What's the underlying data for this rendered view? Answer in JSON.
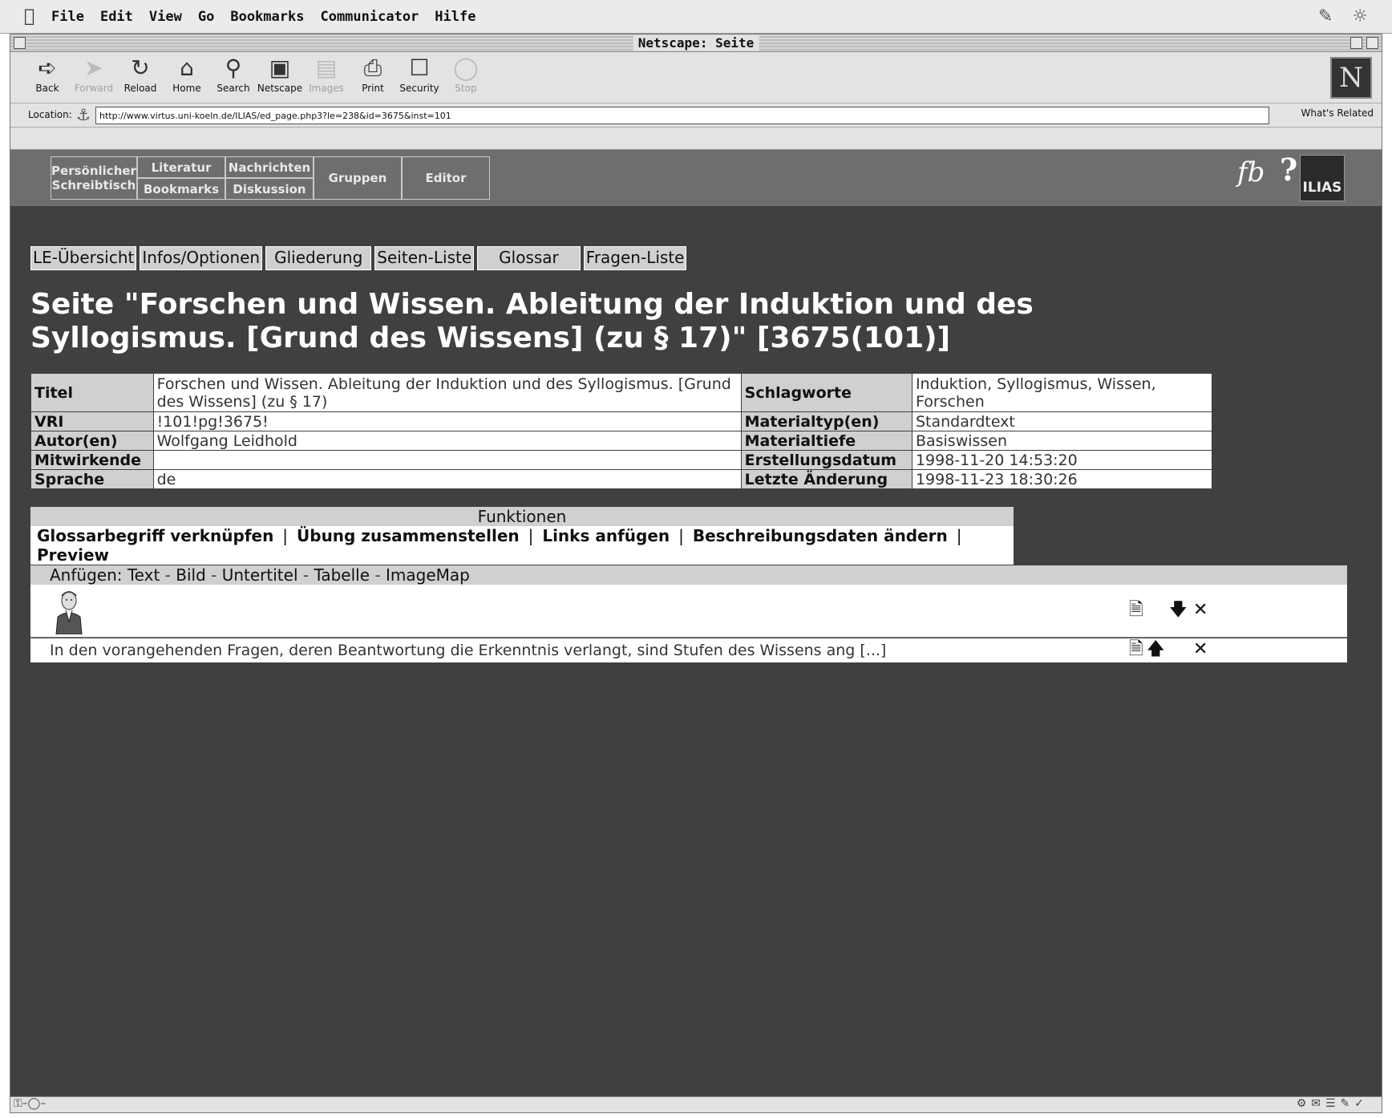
{
  "menubar": {
    "items": [
      "File",
      "Edit",
      "View",
      "Go",
      "Bookmarks",
      "Communicator",
      "Hilfe"
    ]
  },
  "window": {
    "title": "Netscape: Seite"
  },
  "toolbar": {
    "back": "Back",
    "forward": "Forward",
    "reload": "Reload",
    "home": "Home",
    "search": "Search",
    "netscape": "Netscape",
    "images": "Images",
    "print": "Print",
    "security": "Security",
    "stop": "Stop"
  },
  "location": {
    "label": "Location:",
    "url": "http://www.virtus.uni-koeln.de/ILIAS/ed_page.php3?le=238&id=3675&inst=101",
    "whats_related": "What's Related"
  },
  "ilias_nav": {
    "persoenlicher": "Persönlicher Schreibtisch",
    "literatur": "Literatur",
    "bookmarks": "Bookmarks",
    "nachrichten": "Nachrichten",
    "diskussion": "Diskussion",
    "gruppen": "Gruppen",
    "editor": "Editor",
    "logo": "ILIAS",
    "help": "?"
  },
  "tabs": [
    "LE-Übersicht",
    "Infos/Optionen",
    "Gliederung",
    "Seiten-Liste",
    "Glossar",
    "Fragen-Liste"
  ],
  "page_title": "Seite \"Forschen und Wissen. Ableitung der Induktion und des Syllogismus. [Grund des Wissens] (zu § 17)\" [3675(101)]",
  "meta": {
    "titel_label": "Titel",
    "titel": "Forschen und Wissen. Ableitung der Induktion und des Syllogismus. [Grund des Wissens] (zu § 17)",
    "schlagworte_label": "Schlagworte",
    "schlagworte": "Induktion, Syllogismus, Wissen, Forschen",
    "vri_label": "VRI",
    "vri": "!101!pg!3675!",
    "materialtyp_label": "Materialtyp(en)",
    "materialtyp": "Standardtext",
    "autor_label": "Autor(en)",
    "autor": "Wolfgang Leidhold",
    "materialtiefe_label": "Materialtiefe",
    "materialtiefe": "Basiswissen",
    "mitwirkende_label": "Mitwirkende",
    "mitwirkende": "",
    "erstellungsdatum_label": "Erstellungsdatum",
    "erstellungsdatum": "1998-11-20 14:53:20",
    "sprache_label": "Sprache",
    "sprache": "de",
    "letzte_aenderung_label": "Letzte Änderung",
    "letzte_aenderung": "1998-11-23 18:30:26"
  },
  "funktionen": {
    "header": "Funktionen",
    "glossar": "Glossarbegriff verknüpfen",
    "uebung": "Übung zusammenstellen",
    "links": "Links anfügen",
    "beschreibung": "Beschreibungsdaten ändern",
    "preview": "Preview"
  },
  "anfuegen": {
    "label": "Anfügen:",
    "text": "Text",
    "bild": "Bild",
    "untertitel": "Untertitel",
    "tabelle": "Tabelle",
    "imagemap": "ImageMap"
  },
  "paragraph": {
    "text": "In den vorangehenden Fragen, deren Beantwortung die Erkenntnis verlangt, sind Stufen des Wissens ang [...]"
  }
}
